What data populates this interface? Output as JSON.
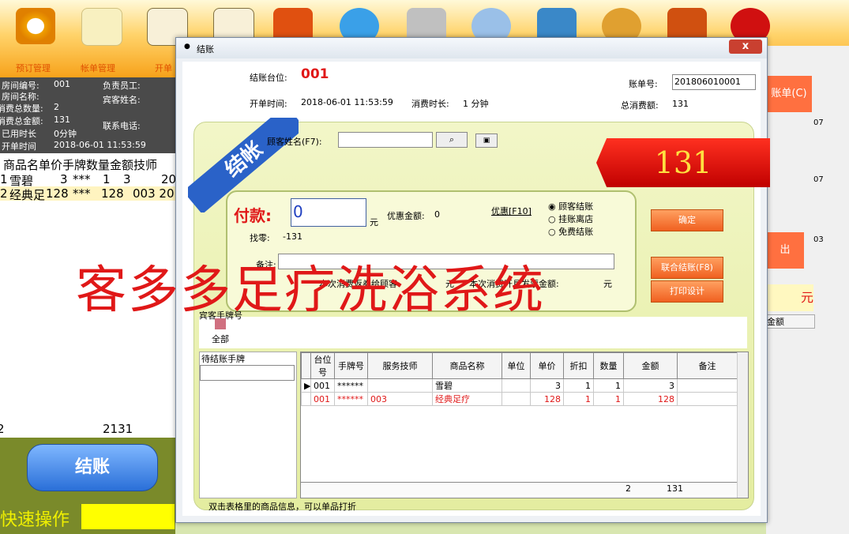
{
  "toolbar": {
    "labels": [
      "预订管理",
      "帐单管理",
      "开单"
    ]
  },
  "left_info": {
    "room_no_label": "房间编号:",
    "room_no": "001",
    "room_name_label": "房间名称:",
    "consume_count_label": "消费总数量:",
    "consume_count": "2",
    "consume_total_label": "消费总金额:",
    "consume_total": "131",
    "used_time_label": "已用时长",
    "used_time": "0分钟",
    "open_time_label": "开单时间",
    "open_time": "2018-06-01 11:53:59",
    "staff_label": "负责员工:",
    "guest_name_label": "宾客姓名:",
    "phone_label": "联系电话:"
  },
  "left_grid": {
    "header": "商品名单价手牌数量金额技师",
    "rows": [
      {
        "idx": "1",
        "name": "雪碧",
        "price": "3",
        "tag": "***",
        "qty": "1",
        "amount": "3",
        "extra": "20"
      },
      {
        "idx": "2",
        "name": "经典足",
        "price": "128",
        "tag": "***",
        "qty": "1",
        "amount": "128",
        "extra": "003 20"
      }
    ],
    "footer_count": "2",
    "footer_total": "2131"
  },
  "left_bottom": {
    "checkout_btn": "结账",
    "quick_label": "快速操作"
  },
  "right_panel": {
    "btn1": "账单(C)",
    "btn2": "出",
    "unit": "元",
    "amount_header": "金额",
    "numbers": [
      "07",
      "07",
      "03"
    ]
  },
  "dialog": {
    "title": "结账",
    "close": "x",
    "table_label": "结账台位:",
    "table_no": "001",
    "bill_no_label": "账单号:",
    "bill_no": "201806010001",
    "open_time_label": "开单时间:",
    "open_time": "2018-06-01 11:53:59",
    "duration_label": "消费时长:",
    "duration": "1 分钟",
    "total_label": "总消费额:",
    "total": "131",
    "ribbon": "结帐",
    "guest_name_label": "顾客姓名(F7):",
    "guest_name_value": "",
    "amount_due": "131",
    "pay_label": "付款:",
    "pay_value": "0",
    "pay_unit": "元",
    "discount_label": "优惠金额:",
    "discount_value": "0",
    "discount_btn": "优惠[F10]",
    "change_label": "找零:",
    "change_value": "-131",
    "radio_options": [
      "顾客结账",
      "挂账离店",
      "免费结账"
    ],
    "remark_label": "备注:",
    "coupon_text": "本次消费返券给顾客:",
    "coupon_unit": "元",
    "invoice_text": "本次消费开具发票金额:",
    "invoice_unit": "元",
    "confirm_btn": "确定",
    "combined_btn": "联合结账(F8)",
    "print_btn": "打印设计",
    "guest_tags_label": "宾客手牌号",
    "guest_tags_all": "全部",
    "pending_label": "待结账手牌",
    "grid": {
      "headers": [
        "台位号",
        "手牌号",
        "服务技师",
        "商品名称",
        "单位",
        "单价",
        "折扣",
        "数量",
        "金额",
        "备注"
      ],
      "rows": [
        [
          "001",
          "******",
          "",
          "雪碧",
          "",
          "3",
          "1",
          "1",
          "3",
          ""
        ],
        [
          "001",
          "******",
          "003",
          "经典足疗",
          "",
          "128",
          "1",
          "1",
          "128",
          ""
        ]
      ],
      "footer_qty": "2",
      "footer_amount": "131"
    },
    "hint": "双击表格里的商品信息，可以单品打折"
  },
  "watermark": "客多多足疗洗浴系统",
  "colors": {
    "accent_red": "#e01818",
    "toolbar_orange": "#f7a21a",
    "button_orange": "#f06020",
    "ribbon_blue": "#2a62c8"
  }
}
